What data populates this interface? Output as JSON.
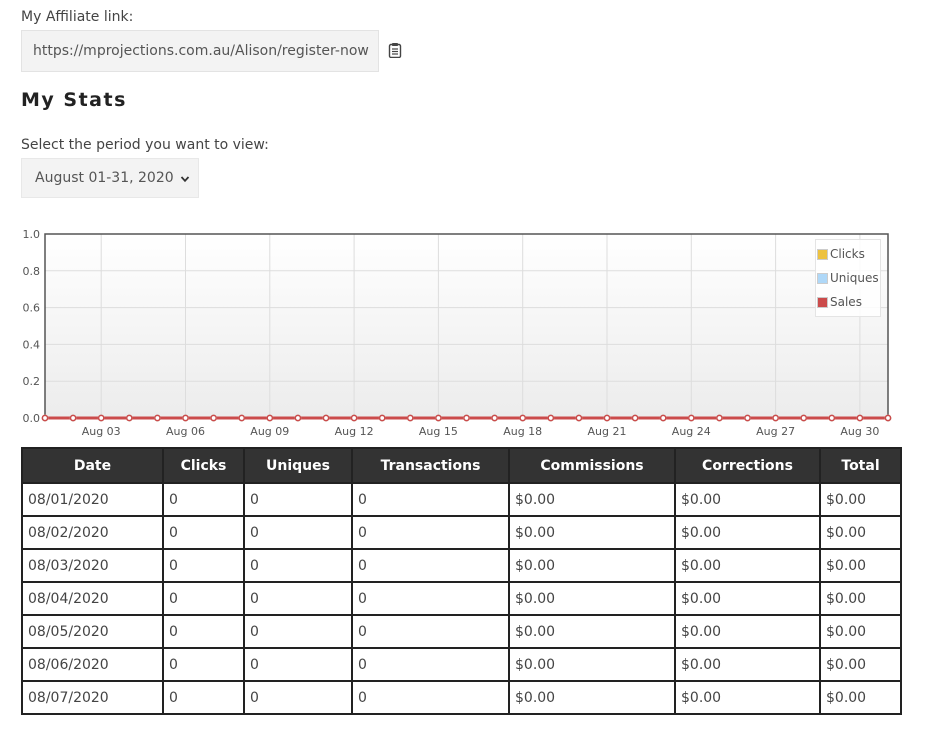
{
  "affiliate": {
    "label": "My Affiliate link:",
    "url": "https://mprojections.com.au/Alison/register-now",
    "copy_icon": "clipboard-icon"
  },
  "stats": {
    "title": "My Stats",
    "period_label": "Select the period you want to view:",
    "period_selected": "August 01-31, 2020",
    "period_icon": "chevron-down-icon"
  },
  "chart_data": {
    "type": "line",
    "title": "",
    "xlabel": "",
    "ylabel": "",
    "x": [
      "Aug 01",
      "Aug 02",
      "Aug 03",
      "Aug 04",
      "Aug 05",
      "Aug 06",
      "Aug 07",
      "Aug 08",
      "Aug 09",
      "Aug 10",
      "Aug 11",
      "Aug 12",
      "Aug 13",
      "Aug 14",
      "Aug 15",
      "Aug 16",
      "Aug 17",
      "Aug 18",
      "Aug 19",
      "Aug 20",
      "Aug 21",
      "Aug 22",
      "Aug 23",
      "Aug 24",
      "Aug 25",
      "Aug 26",
      "Aug 27",
      "Aug 28",
      "Aug 29",
      "Aug 30",
      "Aug 31"
    ],
    "xticks": [
      "Aug 03",
      "Aug 06",
      "Aug 09",
      "Aug 12",
      "Aug 15",
      "Aug 18",
      "Aug 21",
      "Aug 24",
      "Aug 27",
      "Aug 30"
    ],
    "yticks": [
      "0.0",
      "0.2",
      "0.4",
      "0.6",
      "0.8",
      "1.0"
    ],
    "ylim": [
      0,
      1.0
    ],
    "grid": true,
    "legend_position": "top-right",
    "series": [
      {
        "name": "Clicks",
        "color": "#edc240",
        "values": [
          0,
          0,
          0,
          0,
          0,
          0,
          0,
          0,
          0,
          0,
          0,
          0,
          0,
          0,
          0,
          0,
          0,
          0,
          0,
          0,
          0,
          0,
          0,
          0,
          0,
          0,
          0,
          0,
          0,
          0,
          0
        ]
      },
      {
        "name": "Uniques",
        "color": "#afd8f8",
        "values": [
          0,
          0,
          0,
          0,
          0,
          0,
          0,
          0,
          0,
          0,
          0,
          0,
          0,
          0,
          0,
          0,
          0,
          0,
          0,
          0,
          0,
          0,
          0,
          0,
          0,
          0,
          0,
          0,
          0,
          0,
          0
        ]
      },
      {
        "name": "Sales",
        "color": "#cb4b4b",
        "values": [
          0,
          0,
          0,
          0,
          0,
          0,
          0,
          0,
          0,
          0,
          0,
          0,
          0,
          0,
          0,
          0,
          0,
          0,
          0,
          0,
          0,
          0,
          0,
          0,
          0,
          0,
          0,
          0,
          0,
          0,
          0
        ]
      }
    ]
  },
  "table": {
    "headers": [
      "Date",
      "Clicks",
      "Uniques",
      "Transactions",
      "Commissions",
      "Corrections",
      "Total"
    ],
    "rows": [
      [
        "08/01/2020",
        "0",
        "0",
        "0",
        "$0.00",
        "$0.00",
        "$0.00"
      ],
      [
        "08/02/2020",
        "0",
        "0",
        "0",
        "$0.00",
        "$0.00",
        "$0.00"
      ],
      [
        "08/03/2020",
        "0",
        "0",
        "0",
        "$0.00",
        "$0.00",
        "$0.00"
      ],
      [
        "08/04/2020",
        "0",
        "0",
        "0",
        "$0.00",
        "$0.00",
        "$0.00"
      ],
      [
        "08/05/2020",
        "0",
        "0",
        "0",
        "$0.00",
        "$0.00",
        "$0.00"
      ],
      [
        "08/06/2020",
        "0",
        "0",
        "0",
        "$0.00",
        "$0.00",
        "$0.00"
      ],
      [
        "08/07/2020",
        "0",
        "0",
        "0",
        "$0.00",
        "$0.00",
        "$0.00"
      ]
    ]
  }
}
